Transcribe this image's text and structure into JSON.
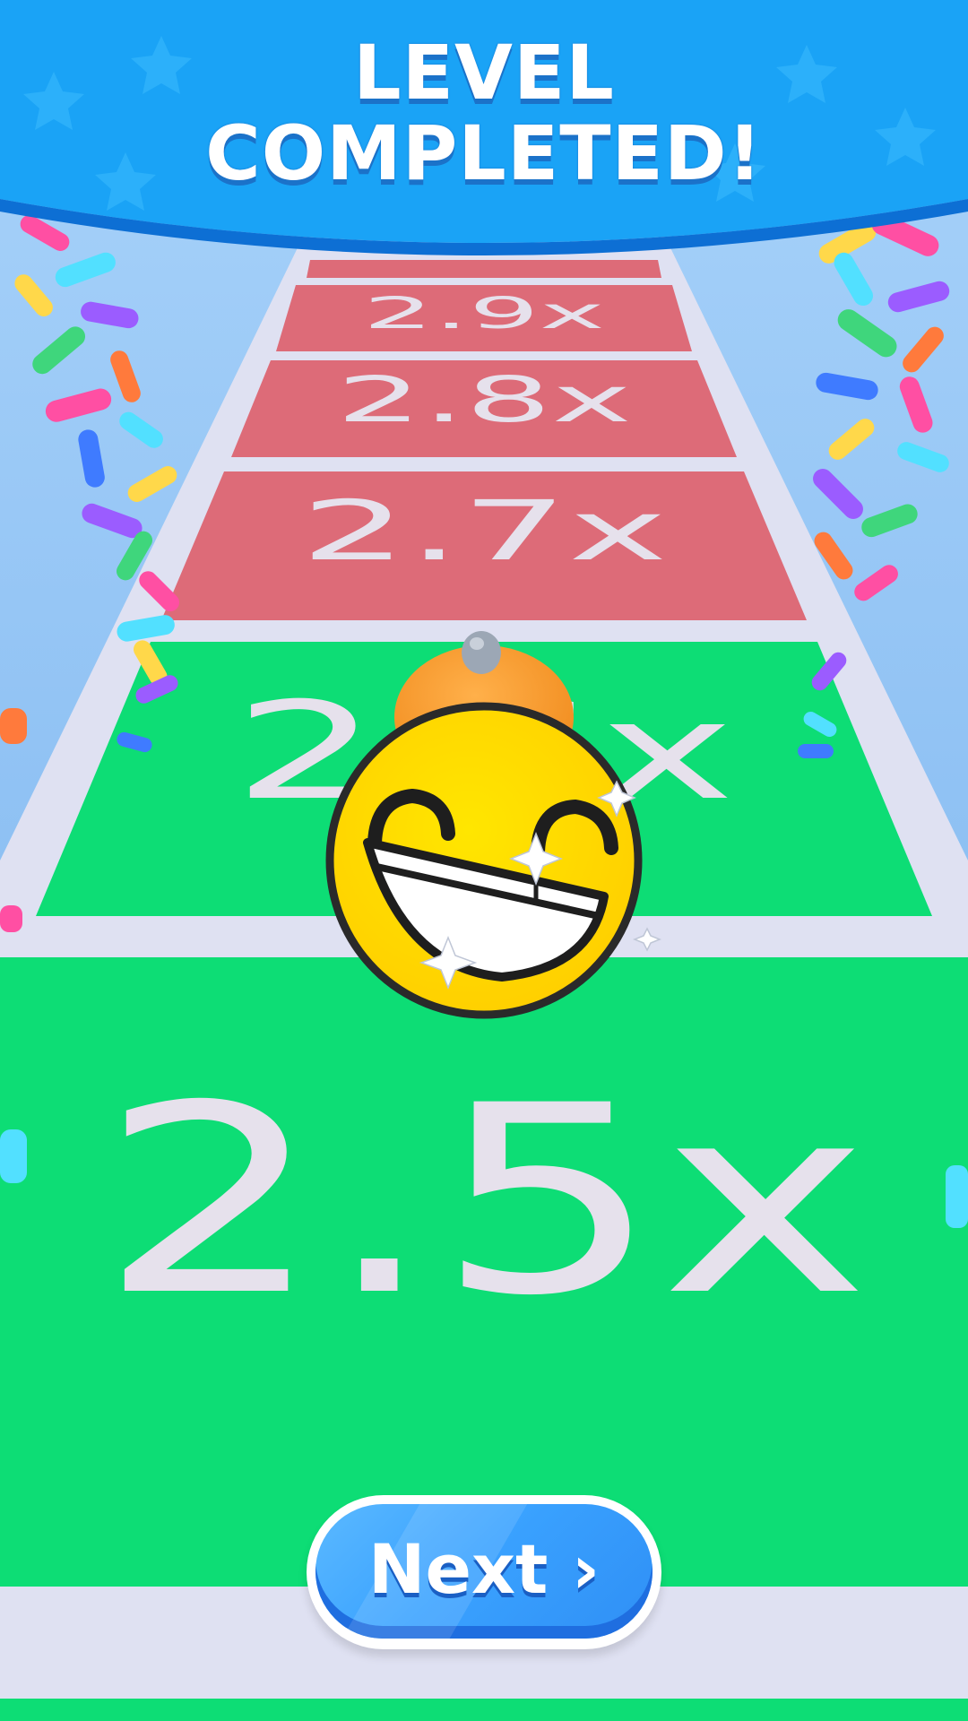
{
  "header": {
    "title_line1": "LEVEL",
    "title_line2": "COMPLETED!"
  },
  "track": {
    "tiles": [
      {
        "label": "2.9x",
        "color": "#dd6b78"
      },
      {
        "label": "2.8x",
        "color": "#dd6b78"
      },
      {
        "label": "2.7x",
        "color": "#dd6b78"
      },
      {
        "label": "2.6x",
        "color": "#0ddd75"
      },
      {
        "label": "2.5x",
        "color": "#0ddd75"
      }
    ],
    "divider_color": "#dfe1f2"
  },
  "character": {
    "face_icon": "grinning-face-icon",
    "hat_icon": "orange-beanie-icon"
  },
  "next_button": {
    "label": "Next ›",
    "icon": "chevron-right-icon"
  },
  "colors": {
    "banner": "#1aa3f6",
    "sky": "#7fb6ef",
    "button": "#3aa2ff"
  }
}
